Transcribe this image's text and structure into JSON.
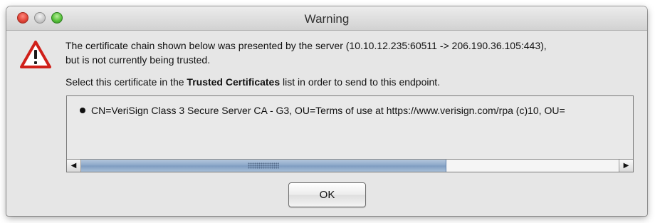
{
  "window": {
    "title": "Warning"
  },
  "message": {
    "line1": "The certificate chain shown below was presented by the server (10.10.12.235:60511 -> 206.190.36.105:443),",
    "line2": "but is not currently being trusted.",
    "instruction_before": "Select this certificate in the ",
    "instruction_bold": "Trusted Certificates",
    "instruction_after": " list in order to send to this endpoint."
  },
  "certificate_list": {
    "items": [
      {
        "label": "CN=VeriSign Class 3 Secure Server CA - G3, OU=Terms of use at https://www.verisign.com/rpa (c)10, OU="
      }
    ],
    "horizontal_scroll_fraction": 0.68
  },
  "buttons": {
    "ok_label": "OK"
  },
  "icons": {
    "warning": "warning-triangle-icon",
    "scroll_left": "arrow-left-icon",
    "scroll_right": "arrow-right-icon"
  },
  "colors": {
    "warning_red": "#d0201a",
    "scroll_thumb": "#8aa6c8",
    "window_bg": "#e6e6e6"
  }
}
